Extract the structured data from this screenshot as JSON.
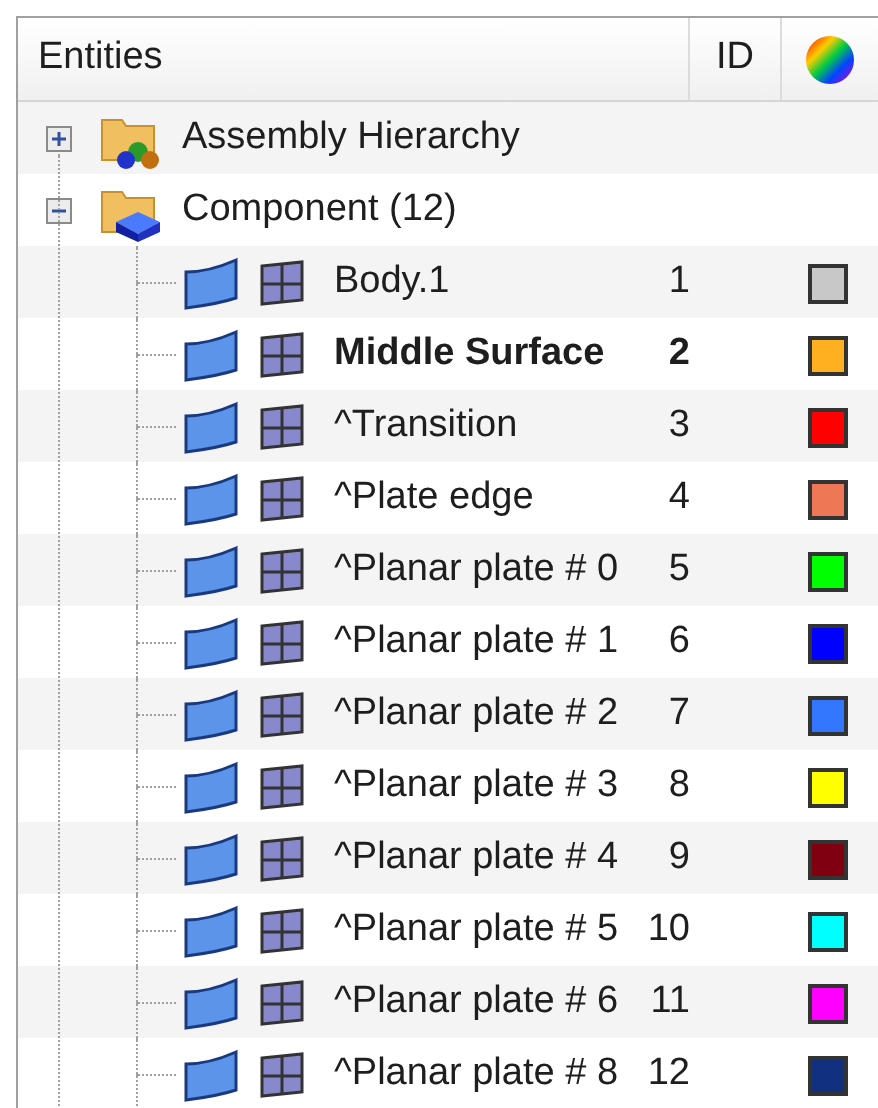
{
  "columns": [
    "Entities",
    "ID"
  ],
  "tree": [
    {
      "label": "Assembly Hierarchy",
      "kind": "assembly",
      "expanded": false
    },
    {
      "label": "Component (12)",
      "kind": "component",
      "expanded": true,
      "children": [
        {
          "label": "Body.1",
          "id": "1",
          "color": "#c8c8c8",
          "bold": false
        },
        {
          "label": "Middle Surface",
          "id": "2",
          "color": "#ffb020",
          "bold": true
        },
        {
          "label": "^Transition",
          "id": "3",
          "color": "#ff0000",
          "bold": false
        },
        {
          "label": "^Plate edge",
          "id": "4",
          "color": "#ee7755",
          "bold": false
        },
        {
          "label": "^Planar plate # 0",
          "id": "5",
          "color": "#00ff00",
          "bold": false
        },
        {
          "label": "^Planar plate # 1",
          "id": "6",
          "color": "#0000ff",
          "bold": false
        },
        {
          "label": "^Planar plate # 2",
          "id": "7",
          "color": "#3377ff",
          "bold": false
        },
        {
          "label": "^Planar plate # 3",
          "id": "8",
          "color": "#ffff00",
          "bold": false
        },
        {
          "label": "^Planar plate # 4",
          "id": "9",
          "color": "#800010",
          "bold": false
        },
        {
          "label": "^Planar plate # 5",
          "id": "10",
          "color": "#00ffff",
          "bold": false
        },
        {
          "label": "^Planar plate # 6",
          "id": "11",
          "color": "#ff00ff",
          "bold": false
        },
        {
          "label": "^Planar plate # 8",
          "id": "12",
          "color": "#123080",
          "bold": false
        }
      ]
    }
  ]
}
